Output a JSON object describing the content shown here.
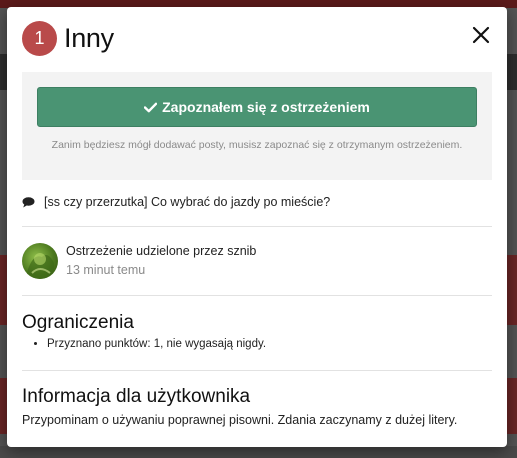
{
  "modal": {
    "badge_count": "1",
    "title": "Inny",
    "close_icon": "close-icon"
  },
  "acknowledge": {
    "button_label": "Zapoznałem się z ostrzeżeniem",
    "button_icon": "checkmark-icon",
    "note": "Zanim będziesz mógł dodawać posty, musisz zapoznać się z otrzymanym ostrzeżeniem.",
    "button_color": "#4a9473"
  },
  "thread": {
    "icon": "comment-icon",
    "title": "[ss czy przerzutka] Co wybrać do jazdy po mieście?"
  },
  "warning_giver": {
    "text": "Ostrzeżenie udzielone przez sznib",
    "time": "13 minut temu"
  },
  "restrictions": {
    "title": "Ograniczenia",
    "items": [
      "Przyznano punktów: 1, nie wygasają nigdy."
    ]
  },
  "user_info": {
    "title": "Informacja dla użytkownika",
    "message": "Przypominam o używaniu poprawnej pisowni. Zdania zaczynamy z dużej litery."
  },
  "colors": {
    "badge": "#b94a4a",
    "backdrop": "#545454"
  }
}
